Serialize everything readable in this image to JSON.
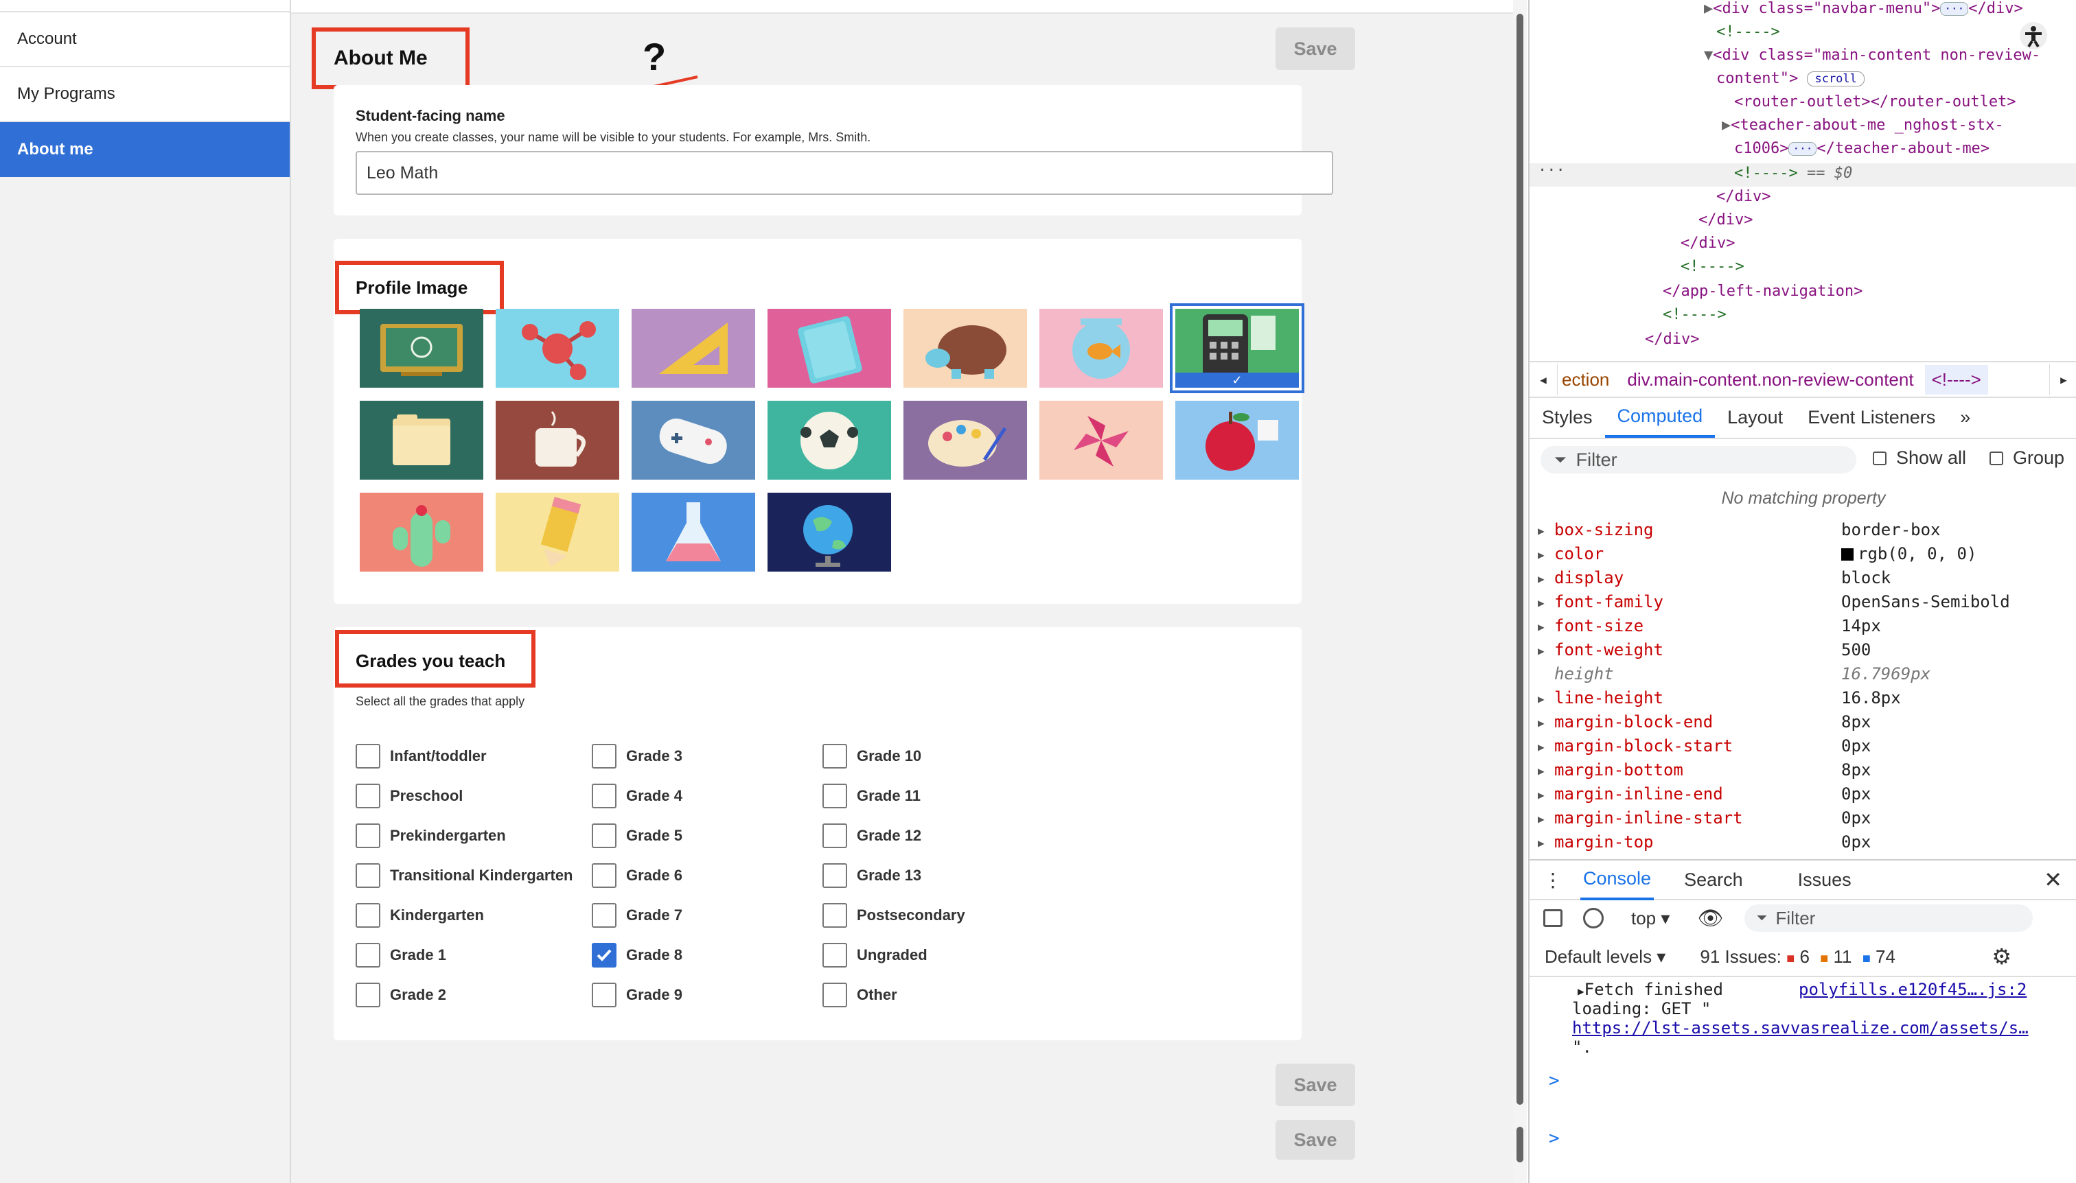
{
  "nav": {
    "items": [
      "Account",
      "My Programs",
      "About me"
    ]
  },
  "header": {
    "title": "About Me",
    "save_label": "Save"
  },
  "annotation": {
    "question_mark": "?"
  },
  "student_name": {
    "label": "Student-facing name",
    "helper": "When you create classes, your name will be visible to your students. For example, Mrs. Smith.",
    "value": "Leo Math"
  },
  "profile_image": {
    "title": "Profile Image",
    "selected_index": 6,
    "images": [
      "chalkboard",
      "molecule",
      "ruler-triangle",
      "notebook",
      "turtle",
      "fishbowl",
      "calculator",
      "folder",
      "coffee-cup",
      "game-controller",
      "soccer-ball",
      "paint-palette",
      "pinwheel",
      "apple",
      "cactus",
      "pencil",
      "flask",
      "globe"
    ]
  },
  "grades": {
    "title": "Grades you teach",
    "helper": "Select all the grades that apply",
    "col1": [
      {
        "label": "Infant/toddler",
        "checked": false
      },
      {
        "label": "Preschool",
        "checked": false
      },
      {
        "label": "Prekindergarten",
        "checked": false
      },
      {
        "label": "Transitional Kindergarten",
        "checked": false
      },
      {
        "label": "Kindergarten",
        "checked": false
      },
      {
        "label": "Grade 1",
        "checked": false
      },
      {
        "label": "Grade 2",
        "checked": false
      }
    ],
    "col2": [
      {
        "label": "Grade 3",
        "checked": false
      },
      {
        "label": "Grade 4",
        "checked": false
      },
      {
        "label": "Grade 5",
        "checked": false
      },
      {
        "label": "Grade 6",
        "checked": false
      },
      {
        "label": "Grade 7",
        "checked": false
      },
      {
        "label": "Grade 8",
        "checked": true
      },
      {
        "label": "Grade 9",
        "checked": false
      }
    ],
    "col3": [
      {
        "label": "Grade 10",
        "checked": false
      },
      {
        "label": "Grade 11",
        "checked": false
      },
      {
        "label": "Grade 12",
        "checked": false
      },
      {
        "label": "Grade 13",
        "checked": false
      },
      {
        "label": "Postsecondary",
        "checked": false
      },
      {
        "label": "Ungraded",
        "checked": false
      },
      {
        "label": "Other",
        "checked": false
      }
    ]
  },
  "devtools": {
    "elements": {
      "l1_tag": "<div class=\"navbar-menu\">",
      "l1_end": "</div>",
      "l2": "<!---->",
      "l3_a": "<div class=\"main-content non-review-",
      "l3_b": "content\">",
      "l3_pill": "scroll",
      "l4": "<router-outlet></router-outlet>",
      "l5_a": "<teacher-about-me _nghost-stx-",
      "l5_b": "c1006>",
      "l5_end": "</teacher-about-me>",
      "l6": "<!---->",
      "l6_sel": "== $0",
      "l7": "</div>",
      "l8": "</div>",
      "l9": "</div>",
      "l10": "<!---->",
      "l11": "</app-left-navigation>",
      "l12": "<!---->",
      "l13": "</div>"
    },
    "breadcrumb": {
      "item1": "ection",
      "item2": "div.main-content.non-review-content",
      "item3": "<!---->"
    },
    "tabs": [
      "Styles",
      "Computed",
      "Layout",
      "Event Listeners"
    ],
    "more_tabs": "»",
    "filter_placeholder": "Filter",
    "show_all_label": "Show all",
    "group_label": "Group",
    "no_matching": "No matching property",
    "properties": [
      {
        "name": "box-sizing",
        "value": "border-box"
      },
      {
        "name": "color",
        "value": "rgb(0, 0, 0)"
      },
      {
        "name": "display",
        "value": "block"
      },
      {
        "name": "font-family",
        "value": "OpenSans-Semibold"
      },
      {
        "name": "font-size",
        "value": "14px"
      },
      {
        "name": "font-weight",
        "value": "500"
      },
      {
        "name": "height",
        "value": "16.7969px"
      },
      {
        "name": "line-height",
        "value": "16.8px"
      },
      {
        "name": "margin-block-end",
        "value": "8px"
      },
      {
        "name": "margin-block-start",
        "value": "0px"
      },
      {
        "name": "margin-bottom",
        "value": "8px"
      },
      {
        "name": "margin-inline-end",
        "value": "0px"
      },
      {
        "name": "margin-inline-start",
        "value": "0px"
      },
      {
        "name": "margin-top",
        "value": "0px"
      }
    ],
    "drawer_tabs": [
      "Console",
      "Search",
      "Issues"
    ],
    "console_context": "top",
    "console_filter": "Filter",
    "default_levels": "Default levels",
    "issues_label": "91 Issues:",
    "issues_errors": "6",
    "issues_warnings": "11",
    "issues_info": "74",
    "log_text1": "Fetch finished",
    "log_link1": "polyfills.e120f45….js:2",
    "log_text2": "loading: GET \"",
    "log_link2": "https://lst-assets.savvasrealize.com/assets/s…",
    "log_text3": "\".",
    "prompt": ">"
  },
  "colors": {
    "accent": "#2f6fd6",
    "annotation_red": "#e53a24",
    "devtools_blue": "#1a73e8"
  }
}
